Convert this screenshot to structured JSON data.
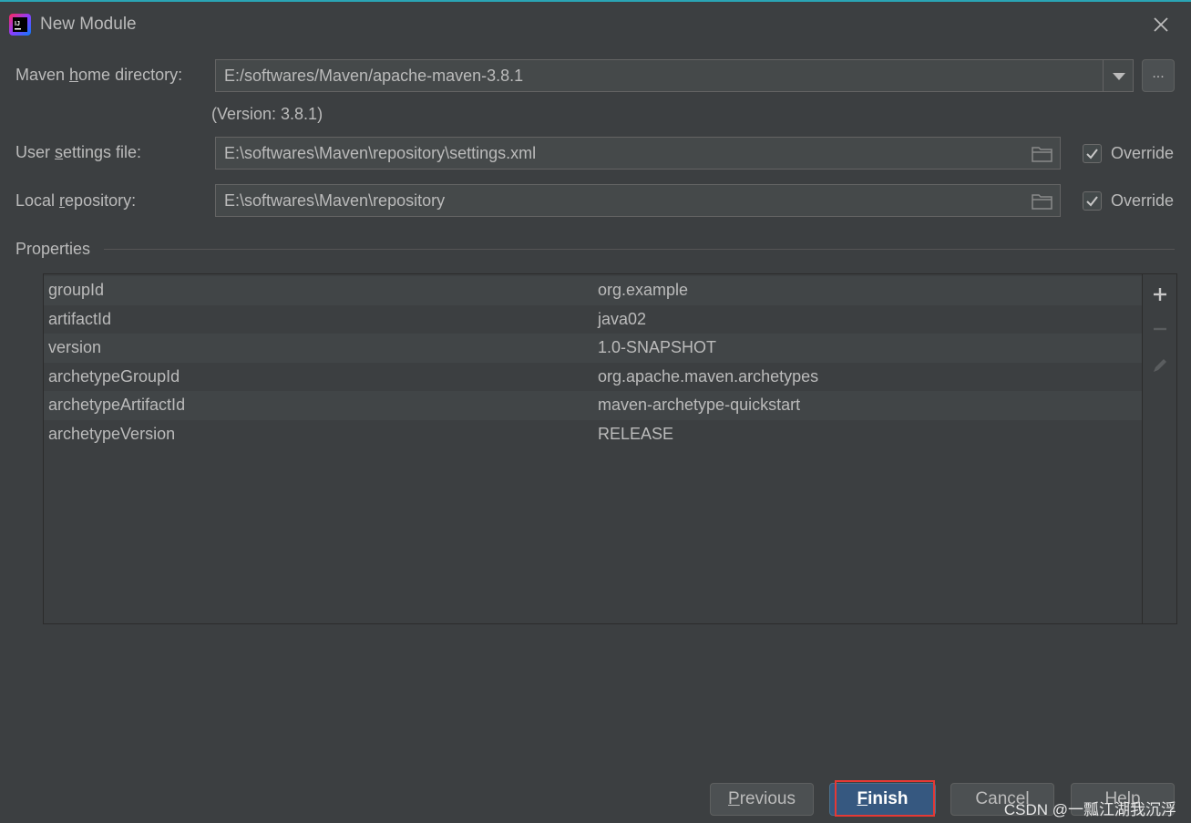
{
  "window": {
    "title": "New Module",
    "close_icon": "close-icon",
    "app_icon": "intellij-idea-icon"
  },
  "maven_home": {
    "label_pre": "Maven ",
    "label_mnemonic": "h",
    "label_post": "ome directory:",
    "value": "E:/softwares/Maven/apache-maven-3.8.1",
    "version": "(Version: 3.8.1)",
    "browse_label": "..."
  },
  "user_settings": {
    "label_pre": "User ",
    "label_mnemonic": "s",
    "label_post": "ettings file:",
    "value": "E:\\softwares\\Maven\\repository\\settings.xml",
    "override_label": "Override",
    "override_checked": true
  },
  "local_repo": {
    "label_pre": "Local ",
    "label_mnemonic": "r",
    "label_post": "epository:",
    "value": "E:\\softwares\\Maven\\repository",
    "override_label": "Override",
    "override_checked": true
  },
  "properties": {
    "title": "Properties",
    "rows": [
      {
        "key": "groupId",
        "value": "org.example"
      },
      {
        "key": "artifactId",
        "value": "java02"
      },
      {
        "key": "version",
        "value": "1.0-SNAPSHOT"
      },
      {
        "key": "archetypeGroupId",
        "value": "org.apache.maven.archetypes"
      },
      {
        "key": "archetypeArtifactId",
        "value": "maven-archetype-quickstart"
      },
      {
        "key": "archetypeVersion",
        "value": "RELEASE"
      }
    ]
  },
  "footer": {
    "previous_mnemonic": "P",
    "previous_rest": "revious",
    "finish_mnemonic": "F",
    "finish_rest": "inish",
    "cancel_label": "Cancel",
    "help_label": "Help"
  },
  "watermark": "CSDN @一瓢江湖我沉浮",
  "colors": {
    "background": "#3c3f41",
    "accent_top": "#2aa5b5",
    "primary_button": "#365880",
    "highlight": "#e53935"
  }
}
